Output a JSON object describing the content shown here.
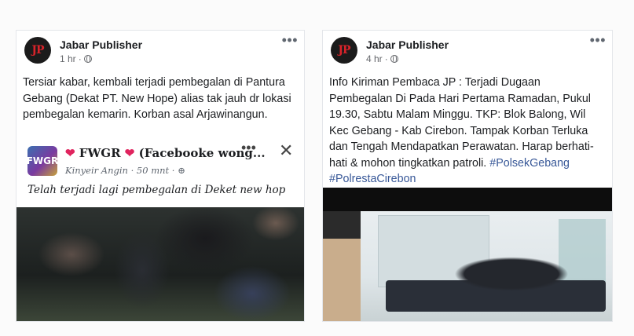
{
  "posts": [
    {
      "author": "Jabar Publisher",
      "avatar_text": "JP",
      "time": "1 hr",
      "privacy_icon": "globe-icon",
      "text": "Tersiar kabar, kembali terjadi pembegalan di Pantura Gebang (Dekat PT. New Hope) alias tak jauh dr lokasi pembegalan kemarin. Korban asal Arjawinangun.",
      "media": {
        "group_avatar_text": "FWGR",
        "group_name_heart_left": "❤",
        "group_name": " FWGR ",
        "group_name_heart_right": "❤",
        "group_name_rest": "  (Facebooke wong...",
        "sub": "Kinyeir Angin · 50 mnt · ⊕",
        "caption": "Telah terjadi lagi pembegalan di Deket new hop"
      }
    },
    {
      "author": "Jabar Publisher",
      "avatar_text": "JP",
      "time": "4 hr",
      "privacy_icon": "globe-icon",
      "text": "Info Kiriman Pembaca JP : Terjadi Dugaan Pembegalan Di Pada Hari Pertama Ramadan, Pukul 19.30, Sabtu Malam Minggu. TKP: Blok Balong, Wil Kec Gebang - Kab Cirebon. Tampak Korban Terluka dan Tengah Mendapatkan Perawatan. Harap berhati-hati & mohon tingkatkan patroli.",
      "hashtags": [
        "#PolsekGebang",
        "#PolrestaCirebon"
      ]
    }
  ],
  "colors": {
    "hashtag": "#385898",
    "heart": "#e0245e",
    "logo": "#d8232a"
  }
}
